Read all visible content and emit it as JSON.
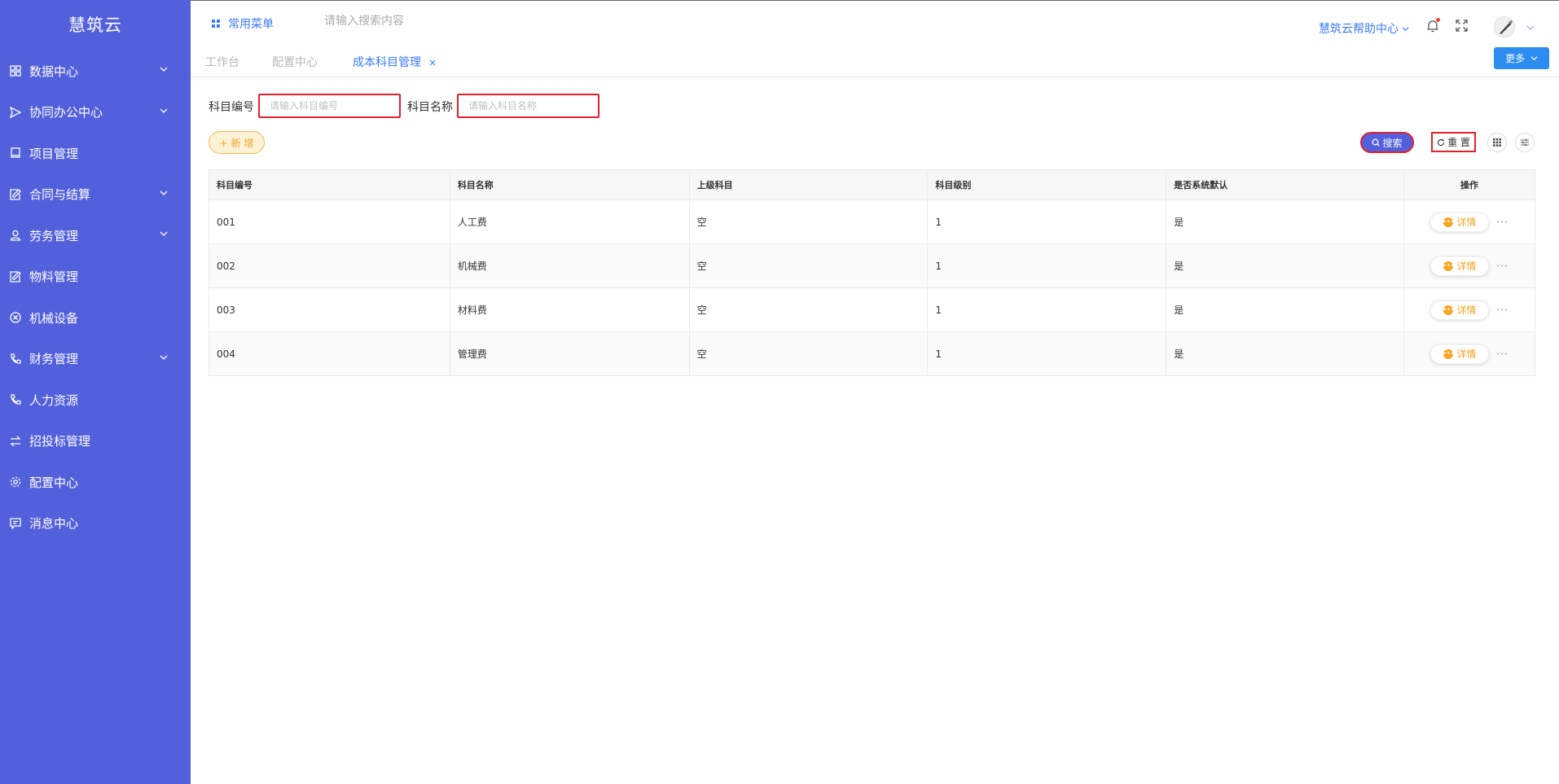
{
  "sidebar": {
    "logo": "慧筑云",
    "items": [
      {
        "label": "数据中心",
        "has_children": true
      },
      {
        "label": "协同办公中心",
        "has_children": true
      },
      {
        "label": "项目管理",
        "has_children": false
      },
      {
        "label": "合同与结算",
        "has_children": true
      },
      {
        "label": "劳务管理",
        "has_children": true
      },
      {
        "label": "物料管理",
        "has_children": false
      },
      {
        "label": "机械设备",
        "has_children": false
      },
      {
        "label": "财务管理",
        "has_children": true
      },
      {
        "label": "人力资源",
        "has_children": false
      },
      {
        "label": "招投标管理",
        "has_children": false
      },
      {
        "label": "配置中心",
        "has_children": false
      },
      {
        "label": "消息中心",
        "has_children": false
      }
    ]
  },
  "header": {
    "common_menu": "常用菜单",
    "search_placeholder": "请输入搜索内容",
    "help_center": "慧筑云帮助中心"
  },
  "tabs": {
    "items": [
      {
        "label": "工作台"
      },
      {
        "label": "配置中心"
      },
      {
        "label": "成本科目管理",
        "close": "×"
      }
    ],
    "more_label": "更多"
  },
  "filters": {
    "code_label": "科目编号",
    "code_placeholder": "请输入科目编号",
    "name_label": "科目名称",
    "name_placeholder": "请输入科目名称"
  },
  "actions": {
    "add_label": "+ 新 增",
    "search_label": "搜索",
    "reset_label": "重 置"
  },
  "table": {
    "columns": [
      "科目编号",
      "科目名称",
      "上级科目",
      "科目级别",
      "是否系统默认",
      "操作"
    ],
    "rows": [
      {
        "code": "001",
        "name": "人工费",
        "parent": "空",
        "level": "1",
        "default": "是",
        "action": "详情"
      },
      {
        "code": "002",
        "name": "机械费",
        "parent": "空",
        "level": "1",
        "default": "是",
        "action": "详情"
      },
      {
        "code": "003",
        "name": "材料费",
        "parent": "空",
        "level": "1",
        "default": "是",
        "action": "详情"
      },
      {
        "code": "004",
        "name": "管理费",
        "parent": "空",
        "level": "1",
        "default": "是",
        "action": "详情"
      }
    ]
  },
  "colors": {
    "sidebar_bg": "#5360dc",
    "accent_blue": "#3a7bff",
    "add_orange": "#f5a623",
    "highlight_red": "#e5202e"
  }
}
